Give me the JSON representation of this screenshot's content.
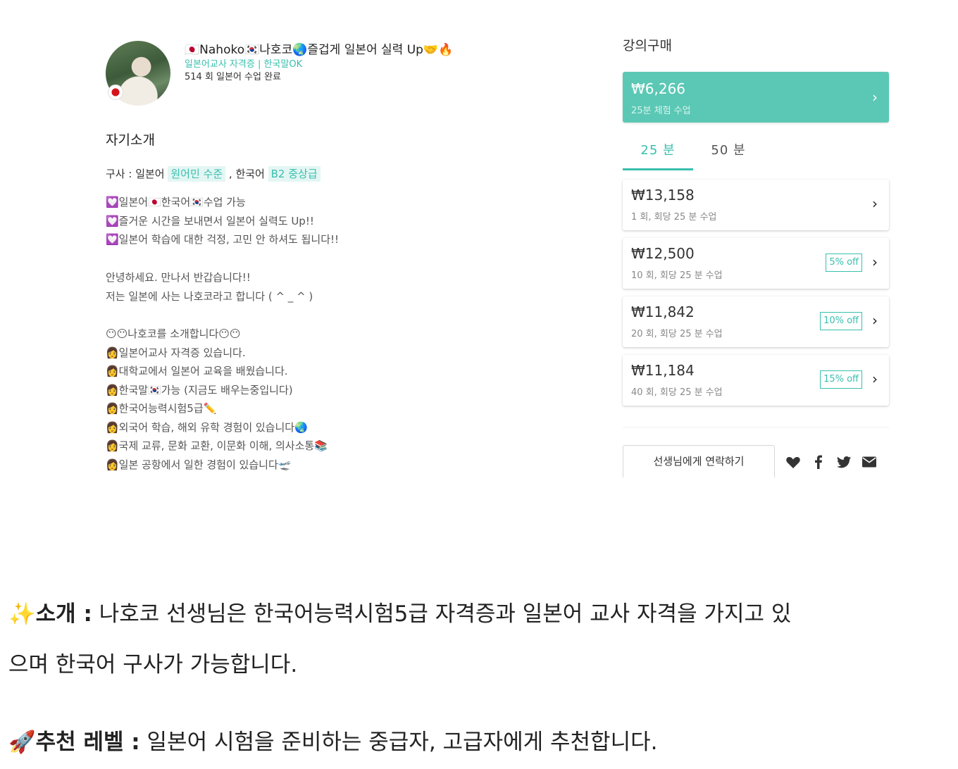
{
  "teacher": {
    "name": "🇯🇵Nahoko🇰🇷나호코🌏즐겁게 일본어 실력 Up🤝🔥",
    "tagline": "일본어교사 자격증 | 한국말OK",
    "lessons_done": "514  회 일본어 수업 완료"
  },
  "intro": {
    "title": "자기소개",
    "langs_prefix": "구사 : 일본어 ",
    "lang1_level": "원어민 수준",
    "langs_mid": " , 한국어 ",
    "lang2_level": "B2 중상급",
    "lines": [
      "💟일본어🇯🇵한국어🇰🇷수업 가능",
      "💟즐거운 시간을 보내면서 일본어 실력도 Up!!",
      "💟일본어 학습에 대한 걱정, 고민 안 하셔도 됩니다!!",
      "안녕하세요. 만나서 반갑습니다!!",
      "저는 일본에 사는 나호코라고 합니다  ( ^ _ ^ )",
      "😶😶나호코를 소개합니다😶😶",
      "👩일본어교사 자격증 있습니다.",
      "👩대학교에서 일본어 교육을 배웠습니다.",
      "👩한국말🇰🇷가능 (지금도 배우는중입니다)",
      "👩한국어능력시험5급✏️",
      "👩외국어 학습, 해외 유학 경험이 있습니다🌏",
      "👩국제 교류, 문화 교환, 이문화 이해, 의사소통📚",
      "👩일본 공항에서 일한 경험이 있습니다🛫"
    ]
  },
  "purchase": {
    "title": "강의구매",
    "trial": {
      "price": "₩6,266",
      "desc": "25분 체험 수업"
    },
    "tabs": [
      "25 분",
      "50 분"
    ],
    "packages": [
      {
        "price": "₩13,158",
        "desc": "1 회, 회당 25 분 수업",
        "discount": ""
      },
      {
        "price": "₩12,500",
        "desc": "10 회, 회당 25 분 수업",
        "discount": "5% off"
      },
      {
        "price": "₩11,842",
        "desc": "20 회, 회당 25 분 수업",
        "discount": "10% off"
      },
      {
        "price": "₩11,184",
        "desc": "40 회, 회당 25 분 수업",
        "discount": "15% off"
      }
    ],
    "contact_label": "선생님에게 연락하기",
    "share_icons": [
      "heart-icon",
      "facebook-icon",
      "twitter-icon",
      "mail-icon"
    ]
  },
  "article": {
    "intro_emoji": "✨",
    "intro_label": "소개 :",
    "intro_line1": " 나호코 선생님은 한국어능력시험5급 자격증과 일본어 교사 자격을 가지고 있",
    "intro_line2": "으며 한국어 구사가 가능합니다.",
    "level_emoji": "🚀",
    "level_label": "추천 레벨 :",
    "level_text": " 일본어 시험을 준비하는 중급자, 고급자에게 추천합니다."
  },
  "colors": {
    "accent": "#38bfae",
    "trial_bg": "#5bc8b5"
  }
}
